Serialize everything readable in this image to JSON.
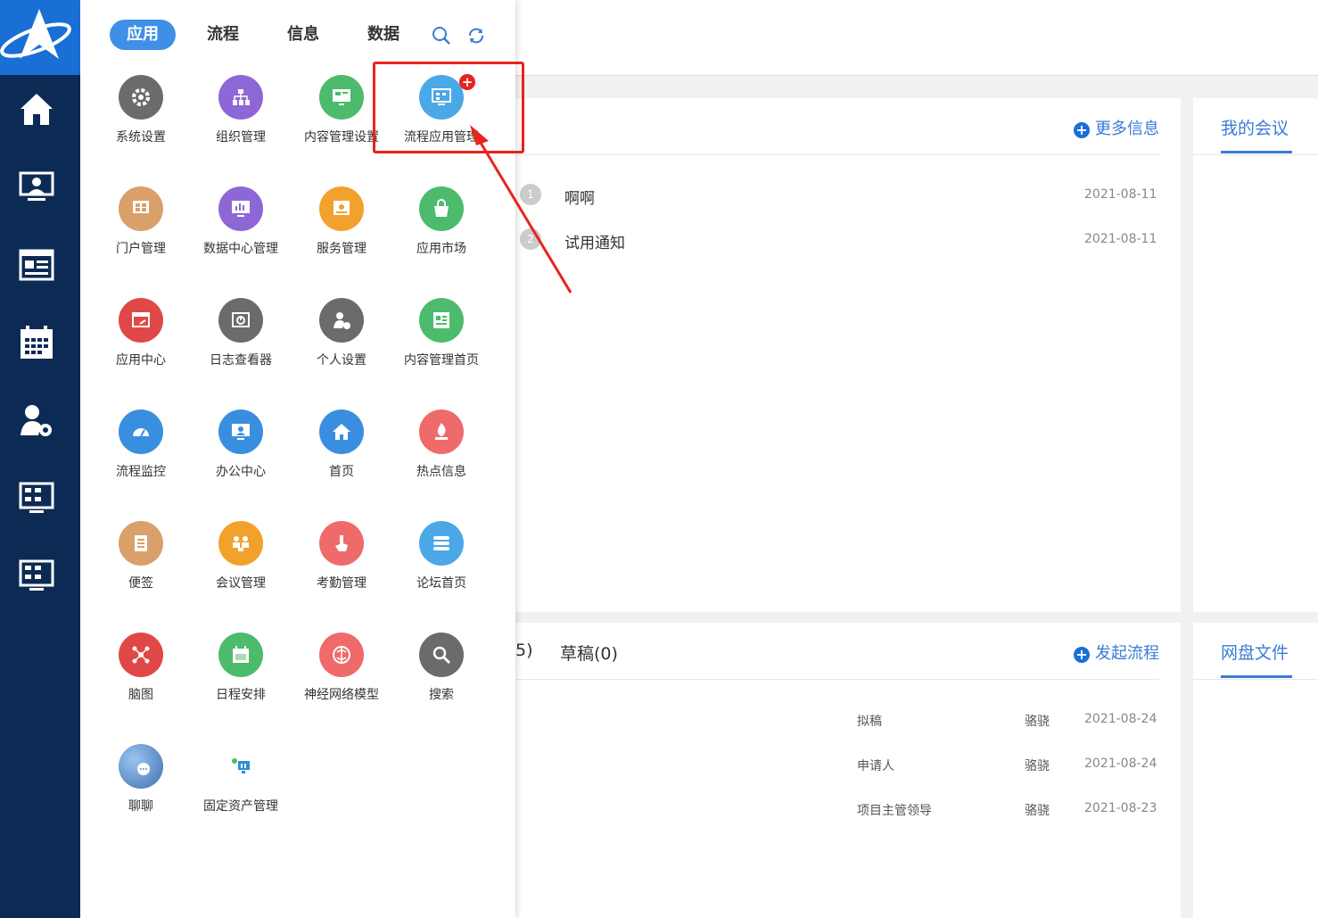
{
  "menu": {
    "tabs": [
      {
        "label": "应用"
      },
      {
        "label": "流程"
      },
      {
        "label": "信息"
      },
      {
        "label": "数据"
      }
    ],
    "apps": [
      {
        "label": "系统设置",
        "color": "#6b6b6b",
        "icon": "gear-icon"
      },
      {
        "label": "组织管理",
        "color": "#8e67d6",
        "icon": "org-icon"
      },
      {
        "label": "内容管理设置",
        "color": "#4cbb6b",
        "icon": "monitor-icon"
      },
      {
        "label": "流程应用管理",
        "color": "#4aa8e6",
        "icon": "flow-monitor-icon"
      },
      {
        "label": "门户管理",
        "color": "#d9a06a",
        "icon": "portal-icon"
      },
      {
        "label": "数据中心管理",
        "color": "#8e67d6",
        "icon": "chart-monitor-icon"
      },
      {
        "label": "服务管理",
        "color": "#f2a12c",
        "icon": "service-icon"
      },
      {
        "label": "应用市场",
        "color": "#4cbb6b",
        "icon": "bag-icon"
      },
      {
        "label": "应用中心",
        "color": "#e04848",
        "icon": "app-center-icon"
      },
      {
        "label": "日志查看器",
        "color": "#6b6b6b",
        "icon": "log-icon"
      },
      {
        "label": "个人设置",
        "color": "#6b6b6b",
        "icon": "user-gear-icon"
      },
      {
        "label": "内容管理首页",
        "color": "#4cbb6b",
        "icon": "news-icon"
      },
      {
        "label": "流程监控",
        "color": "#3a8ee0",
        "icon": "gauge-icon"
      },
      {
        "label": "办公中心",
        "color": "#3a8ee0",
        "icon": "office-icon"
      },
      {
        "label": "首页",
        "color": "#3a8ee0",
        "icon": "home-icon"
      },
      {
        "label": "热点信息",
        "color": "#ef6a6a",
        "icon": "fire-icon"
      },
      {
        "label": "便签",
        "color": "#d9a06a",
        "icon": "note-icon"
      },
      {
        "label": "会议管理",
        "color": "#f2a12c",
        "icon": "meeting-icon"
      },
      {
        "label": "考勤管理",
        "color": "#ef6a6a",
        "icon": "touch-icon"
      },
      {
        "label": "论坛首页",
        "color": "#4aa8e6",
        "icon": "forum-icon"
      },
      {
        "label": "脑图",
        "color": "#e04848",
        "icon": "mindmap-icon"
      },
      {
        "label": "日程安排",
        "color": "#4cbb6b",
        "icon": "calendar-icon"
      },
      {
        "label": "神经网络模型",
        "color": "#ef6a6a",
        "icon": "brain-icon"
      },
      {
        "label": "搜索",
        "color": "#6b6b6b",
        "icon": "search-icon"
      },
      {
        "label": "聊聊",
        "color": "#5b8fd0",
        "icon": "chat-icon"
      },
      {
        "label": "固定资产管理",
        "color": "#2a8fd6",
        "icon": "asset-icon"
      }
    ]
  },
  "info_panel": {
    "more_label": "更多信息",
    "items": [
      {
        "num": "1",
        "title": "啊啊",
        "date": "2021-08-11"
      },
      {
        "num": "2",
        "title": "试用通知",
        "date": "2021-08-11"
      }
    ]
  },
  "meeting_panel": {
    "title": "我的会议"
  },
  "flow_panel": {
    "partial_tab": "5)",
    "draft_tab": "草稿(0)",
    "start_label": "发起流程",
    "rows": [
      {
        "step": "拟稿",
        "person": "骆骁",
        "date": "2021-08-24"
      },
      {
        "step": "申请人",
        "person": "骆骁",
        "date": "2021-08-24"
      },
      {
        "step": "项目主管领导",
        "person": "骆骁",
        "date": "2021-08-23"
      }
    ]
  },
  "disk_panel": {
    "title": "网盘文件"
  },
  "colors": {
    "sidebar": "#0c2b54",
    "accent": "#1a6fd6",
    "highlight": "#e8241c"
  }
}
